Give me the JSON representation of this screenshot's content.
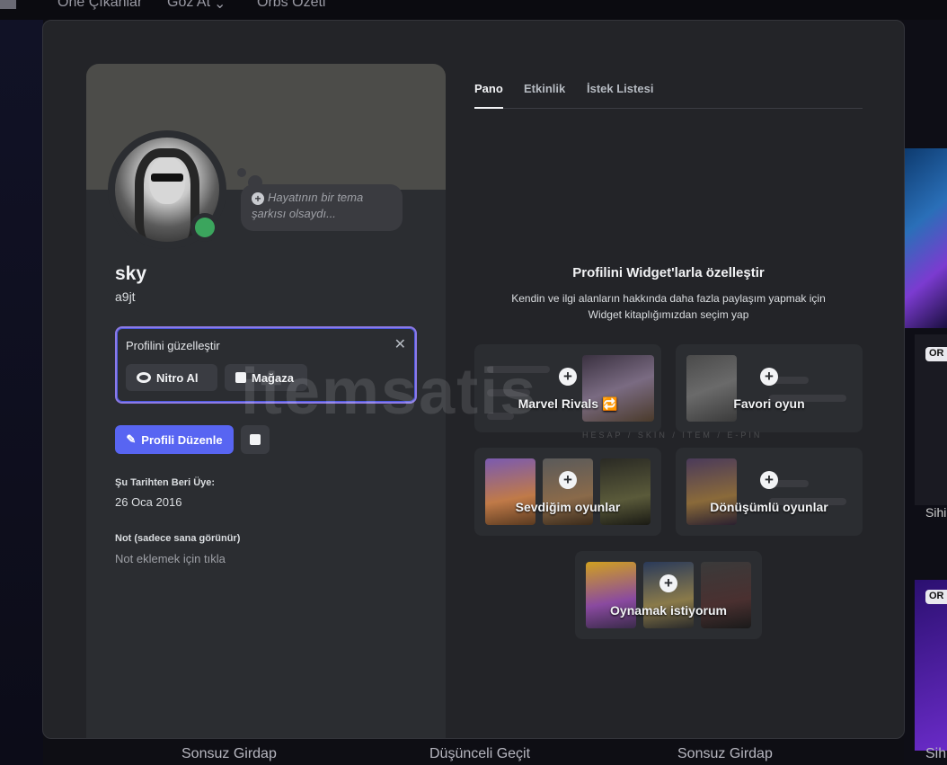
{
  "background": {
    "nav": [
      "Öne Çıkanlar",
      "Göz At",
      "Orbs Özeti"
    ],
    "badges": [
      "OR",
      "OR"
    ],
    "side_text": "Sihi",
    "bottom": [
      "Sonsuz Girdap",
      "Düşünceli Geçit",
      "Sonsuz Girdap",
      "Sihi"
    ]
  },
  "profile": {
    "song_placeholder": "Hayatının bir tema şarkısı olsaydı...",
    "display_name": "sky",
    "username": "a9jt",
    "customize_title": "Profilini güzelleştir",
    "nitro_label": "Nitro Al",
    "shop_label": "Mağaza",
    "edit_label": "Profili Düzenle",
    "member_since_label": "Şu Tarihten Beri Üye:",
    "member_since_value": "26 Oca 2016",
    "note_label": "Not (sadece sana görünür)",
    "note_placeholder": "Not eklemek için tıkla"
  },
  "tabs": [
    "Pano",
    "Etkinlik",
    "İstek Listesi"
  ],
  "widgets": {
    "title": "Profilini Widget'larla özelleştir",
    "description": "Kendin ve ilgi alanların hakkında daha fazla paylaşım yapmak için Widget kitaplığımızdan seçim yap",
    "items": [
      {
        "label": "Marvel Rivals 🔁"
      },
      {
        "label": "Favori oyun"
      },
      {
        "label": "Sevdiğim oyunlar"
      },
      {
        "label": "Dönüşümlü oyunlar"
      },
      {
        "label": "Oynamak istiyorum"
      }
    ]
  },
  "watermark": {
    "text": "itemsatis",
    "sub": "HESAP / SKIN / ITEM / E-PIN"
  },
  "colors": {
    "accent": "#5865f2",
    "online": "#3ba55d",
    "customize_border": "#8c7ae6"
  }
}
